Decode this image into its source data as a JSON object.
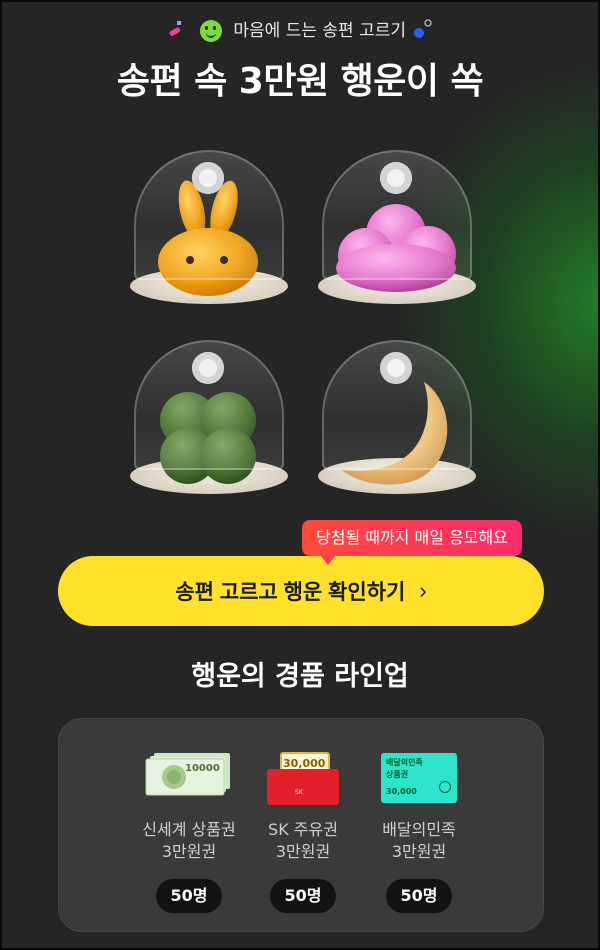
{
  "header": {
    "subtitle": "마음에 드는 송편 고르기",
    "title": "송편 속 3만원 행운이 쏙"
  },
  "songpyeon": [
    {
      "name": "rabbit",
      "color": "#f4a716"
    },
    {
      "name": "cloud",
      "color": "#e470c8"
    },
    {
      "name": "clover",
      "color": "#4d7a35"
    },
    {
      "name": "moon",
      "color": "#f2c982"
    }
  ],
  "tooltip": {
    "text": "당첨될 때까지 매일 응모해요"
  },
  "cta": {
    "label": "송편 고르고 행운 확인하기",
    "chevron": "›"
  },
  "prizes": {
    "title": "행운의 경품 라인업",
    "items": [
      {
        "name": "신세계 상품권",
        "amount": "3만원권",
        "count": "50명",
        "card_value": "10000"
      },
      {
        "name": "SK 주유권",
        "amount": "3만원권",
        "count": "50명",
        "card_value": "30,000",
        "card_brand": "SK"
      },
      {
        "name": "배달의민족",
        "amount": "3만원권",
        "count": "50명",
        "card_brand": "배달의민족",
        "card_type": "상품권",
        "card_value": "30,000"
      }
    ]
  },
  "colors": {
    "accent": "#ffe12a",
    "background": "#252525",
    "tooltip": "#ff3b55"
  }
}
